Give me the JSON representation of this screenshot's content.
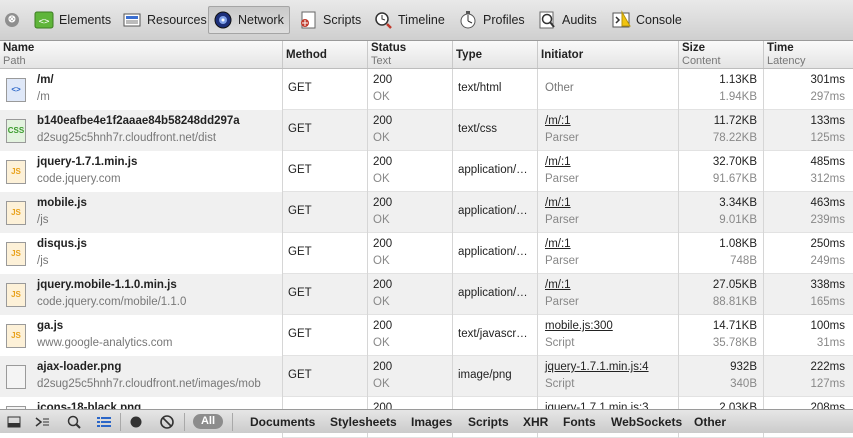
{
  "toolbar": {
    "close_glyph": "⊗",
    "tabs": [
      {
        "label": "Elements",
        "icon": "elements-icon"
      },
      {
        "label": "Resources",
        "icon": "resources-icon"
      },
      {
        "label": "Network",
        "icon": "network-icon"
      },
      {
        "label": "Scripts",
        "icon": "scripts-icon"
      },
      {
        "label": "Timeline",
        "icon": "timeline-icon"
      },
      {
        "label": "Profiles",
        "icon": "profiles-icon"
      },
      {
        "label": "Audits",
        "icon": "audits-icon"
      },
      {
        "label": "Console",
        "icon": "console-icon"
      }
    ],
    "active_tab": "Network"
  },
  "columns": [
    {
      "title": "Name",
      "sub": "Path"
    },
    {
      "title": "Method",
      "sub": ""
    },
    {
      "title": "Status",
      "sub": "Text"
    },
    {
      "title": "Type",
      "sub": ""
    },
    {
      "title": "Initiator",
      "sub": ""
    },
    {
      "title": "Size",
      "sub": "Content"
    },
    {
      "title": "Time",
      "sub": "Latency"
    }
  ],
  "rows": [
    {
      "icon": "html",
      "name": "/m/",
      "path": "/m",
      "method": "GET",
      "status": "200",
      "status_text": "OK",
      "type": "text/html",
      "initiator": "Other",
      "initiator_sub": "",
      "size": "1.13KB",
      "content": "1.94KB",
      "time": "301ms",
      "latency": "297ms"
    },
    {
      "icon": "css",
      "name": "b140eafbe4e1f2aaae84b58248dd297a",
      "path": "d2sug25c5hnh7r.cloudfront.net/dist",
      "method": "GET",
      "status": "200",
      "status_text": "OK",
      "type": "text/css",
      "initiator": "/m/:1",
      "initiator_sub": "Parser",
      "size": "11.72KB",
      "content": "78.22KB",
      "time": "133ms",
      "latency": "125ms"
    },
    {
      "icon": "js",
      "name": "jquery-1.7.1.min.js",
      "path": "code.jquery.com",
      "method": "GET",
      "status": "200",
      "status_text": "OK",
      "type": "application/…",
      "initiator": "/m/:1",
      "initiator_sub": "Parser",
      "size": "32.70KB",
      "content": "91.67KB",
      "time": "485ms",
      "latency": "312ms"
    },
    {
      "icon": "js",
      "name": "mobile.js",
      "path": "/js",
      "method": "GET",
      "status": "200",
      "status_text": "OK",
      "type": "application/…",
      "initiator": "/m/:1",
      "initiator_sub": "Parser",
      "size": "3.34KB",
      "content": "9.01KB",
      "time": "463ms",
      "latency": "239ms"
    },
    {
      "icon": "js",
      "name": "disqus.js",
      "path": "/js",
      "method": "GET",
      "status": "200",
      "status_text": "OK",
      "type": "application/…",
      "initiator": "/m/:1",
      "initiator_sub": "Parser",
      "size": "1.08KB",
      "content": "748B",
      "time": "250ms",
      "latency": "249ms"
    },
    {
      "icon": "js",
      "name": "jquery.mobile-1.1.0.min.js",
      "path": "code.jquery.com/mobile/1.1.0",
      "method": "GET",
      "status": "200",
      "status_text": "OK",
      "type": "application/…",
      "initiator": "/m/:1",
      "initiator_sub": "Parser",
      "size": "27.05KB",
      "content": "88.81KB",
      "time": "338ms",
      "latency": "165ms"
    },
    {
      "icon": "js",
      "name": "ga.js",
      "path": "www.google-analytics.com",
      "method": "GET",
      "status": "200",
      "status_text": "OK",
      "type": "text/javascr…",
      "initiator": "mobile.js:300",
      "initiator_sub": "Script",
      "size": "14.71KB",
      "content": "35.78KB",
      "time": "100ms",
      "latency": "31ms"
    },
    {
      "icon": "img",
      "name": "ajax-loader.png",
      "path": "d2sug25c5hnh7r.cloudfront.net/images/mob",
      "method": "GET",
      "status": "200",
      "status_text": "OK",
      "type": "image/png",
      "initiator": "jquery-1.7.1.min.js:4",
      "initiator_sub": "Script",
      "size": "932B",
      "content": "340B",
      "time": "222ms",
      "latency": "127ms"
    },
    {
      "icon": "img",
      "name": "icons-18-black.png",
      "path": "",
      "method": "GET",
      "status": "200",
      "status_text": "",
      "type": "",
      "initiator": "jquery-1.7.1.min.js:3",
      "initiator_sub": "",
      "size": "2.03KB",
      "content": "",
      "time": "208ms",
      "latency": ""
    }
  ],
  "filters": {
    "all_label": "All",
    "items": [
      "Documents",
      "Stylesheets",
      "Images",
      "Scripts",
      "XHR",
      "Fonts",
      "WebSockets",
      "Other"
    ]
  },
  "colors": {
    "js_icon": "#e8a11b",
    "css_icon": "#3a9b2c",
    "html_icon": "#2b66c8"
  }
}
